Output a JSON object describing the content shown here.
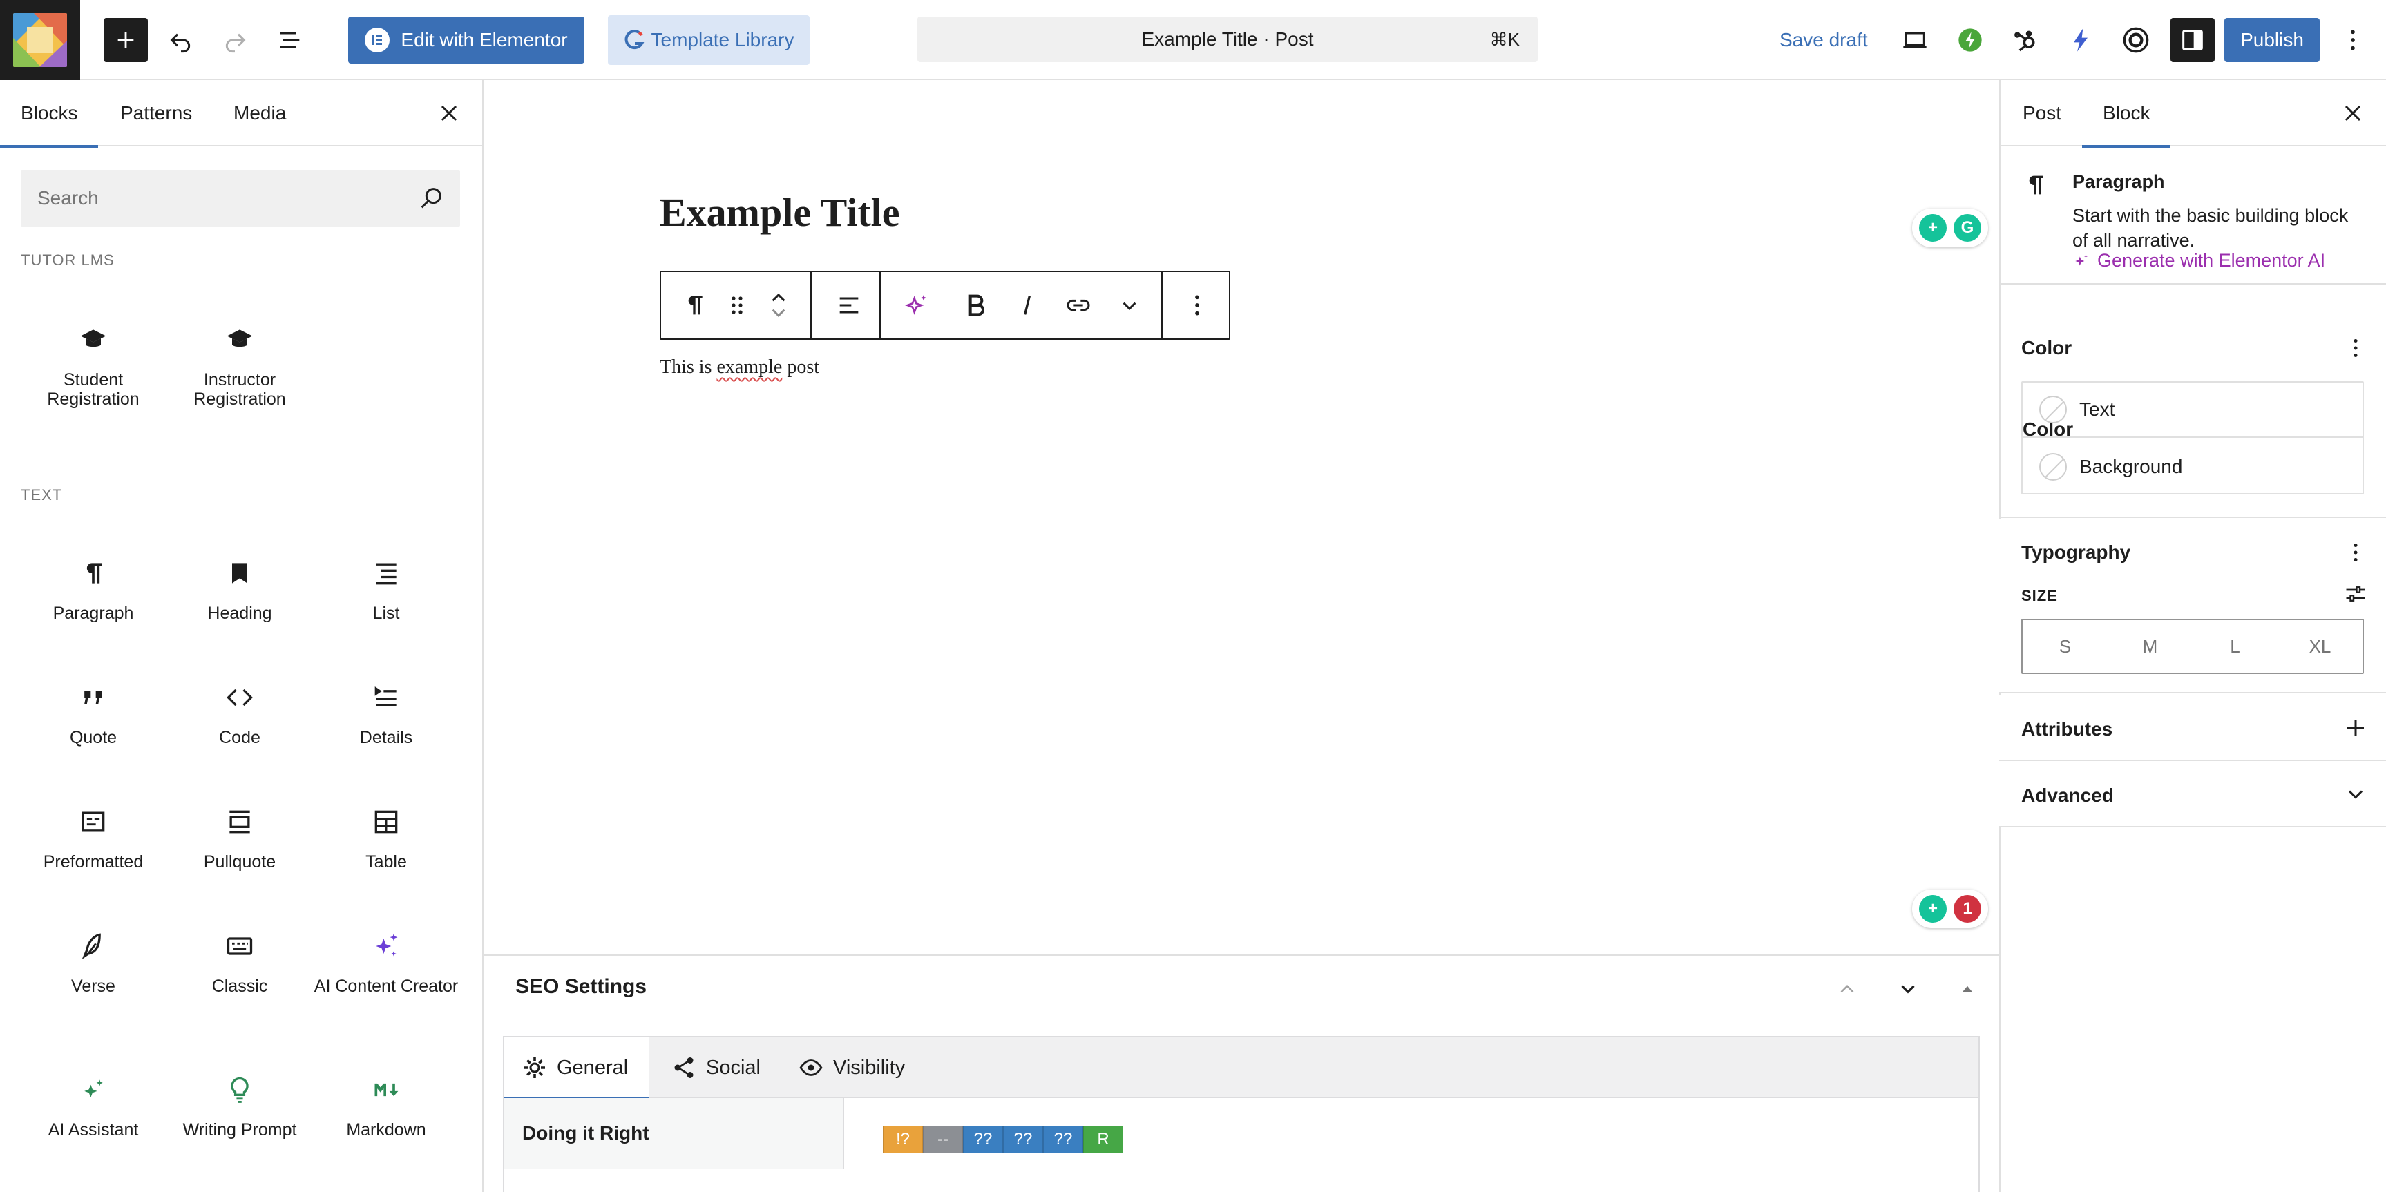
{
  "toolbar": {
    "elementor_label": "Edit with Elementor",
    "template_library_label": "Template Library",
    "doc_title": "Example Title · Post",
    "shortcut": "⌘K",
    "save_draft": "Save draft",
    "publish": "Publish"
  },
  "inserter": {
    "tabs": [
      "Blocks",
      "Patterns",
      "Media"
    ],
    "search_placeholder": "Search",
    "categories": [
      {
        "label": "TUTOR LMS",
        "items": [
          "Student Registration",
          "Instructor Registration"
        ]
      },
      {
        "label": "TEXT",
        "items": [
          "Paragraph",
          "Heading",
          "List",
          "Quote",
          "Code",
          "Details",
          "Preformatted",
          "Pullquote",
          "Table",
          "Verse",
          "Classic",
          "AI Content Creator",
          "AI Assistant",
          "Writing Prompt",
          "Markdown"
        ]
      }
    ]
  },
  "editor": {
    "title": "Example Title",
    "body_before": "This is ",
    "body_misspelled": "example",
    "body_after": " post",
    "grammarly_count": "1"
  },
  "seo": {
    "title": "SEO Settings",
    "tabs": [
      "General",
      "Social",
      "Visibility"
    ],
    "row_label": "Doing it Right",
    "badges": [
      {
        "text": "!?",
        "color": "#e9a23b"
      },
      {
        "text": "--",
        "color": "#8c8f94"
      },
      {
        "text": "??",
        "color": "#3a7fc1"
      },
      {
        "text": "??",
        "color": "#3a7fc1"
      },
      {
        "text": "??",
        "color": "#3a7fc1"
      },
      {
        "text": "R",
        "color": "#46a746"
      }
    ]
  },
  "sidebar": {
    "tabs": [
      "Post",
      "Block"
    ],
    "block_name": "Paragraph",
    "block_desc": "Start with the basic building block of all narrative.",
    "ai_link": "Generate with Elementor AI",
    "color_heading": "Color",
    "color_items": [
      "Text",
      "Background"
    ],
    "typography_heading": "Typography",
    "size_label": "SIZE",
    "sizes": [
      "S",
      "M",
      "L",
      "XL"
    ],
    "attributes_heading": "Attributes",
    "advanced_heading": "Advanced"
  },
  "colors": {
    "accent": "#3a6fb5",
    "ai_purple": "#9b2fae",
    "grammarly_green": "#15c39a",
    "grammarly_red": "#d03240"
  }
}
